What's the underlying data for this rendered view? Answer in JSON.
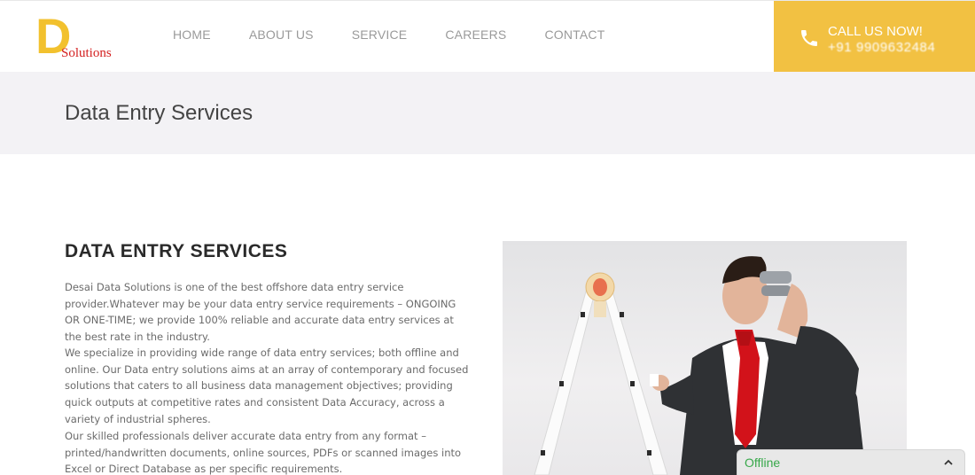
{
  "brand": {
    "logo_letter": "D",
    "logo_text": "Solutions",
    "accent_color": "#f2c12e",
    "logo_text_color": "#d42020"
  },
  "nav": {
    "items": [
      {
        "label": "HOME"
      },
      {
        "label": "ABOUT US"
      },
      {
        "label": "SERVICE"
      },
      {
        "label": "CAREERS"
      },
      {
        "label": "CONTACT"
      }
    ]
  },
  "call": {
    "label": "CALL US NOW!",
    "number": "+91 9909632484",
    "icon": "phone-icon",
    "background": "#f2c142"
  },
  "page": {
    "title": "Data Entry Services"
  },
  "content": {
    "heading": "DATA ENTRY SERVICES",
    "paragraphs": [
      "Desai Data Solutions is one of the best offshore data entry service provider.Whatever may be your data entry service requirements – ONGOING OR ONE-TIME; we provide 100% reliable and accurate data entry services at the best rate in the industry.",
      "We specialize in providing wide range of data entry services; both offline and online. Our Data entry solutions aims at an array of contemporary and focused solutions that caters to all business data management objectives; providing quick outputs at competitive rates and consistent Data Accuracy, across a variety of industrial spheres.",
      "Our skilled professionals deliver accurate data entry from any format – printed/handwritten documents, online sources, PDFs or scanned images into Excel or Direct Database as per specific requirements."
    ]
  },
  "chat": {
    "status": "Offline",
    "status_color": "#37a84a",
    "toggle_icon": "chevron-up-icon"
  }
}
